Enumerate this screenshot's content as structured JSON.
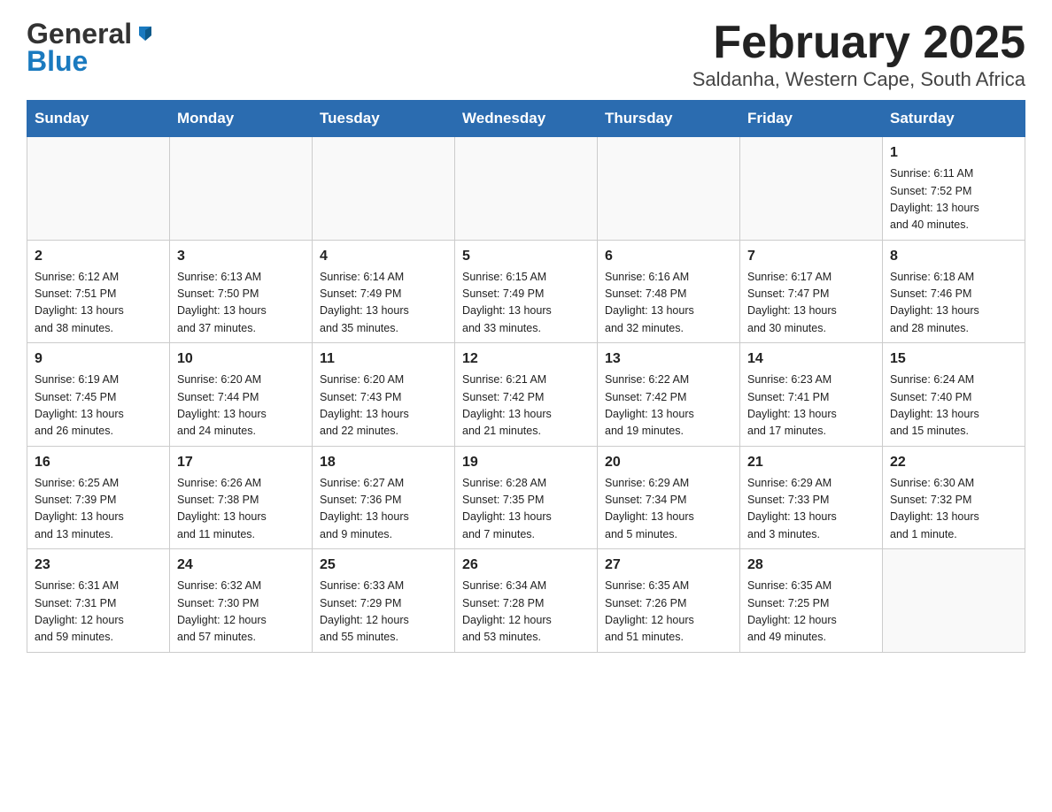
{
  "header": {
    "logo_general": "General",
    "logo_blue": "Blue",
    "title": "February 2025",
    "subtitle": "Saldanha, Western Cape, South Africa"
  },
  "days_of_week": [
    "Sunday",
    "Monday",
    "Tuesday",
    "Wednesday",
    "Thursday",
    "Friday",
    "Saturday"
  ],
  "weeks": [
    [
      {
        "day": "",
        "info": ""
      },
      {
        "day": "",
        "info": ""
      },
      {
        "day": "",
        "info": ""
      },
      {
        "day": "",
        "info": ""
      },
      {
        "day": "",
        "info": ""
      },
      {
        "day": "",
        "info": ""
      },
      {
        "day": "1",
        "info": "Sunrise: 6:11 AM\nSunset: 7:52 PM\nDaylight: 13 hours\nand 40 minutes."
      }
    ],
    [
      {
        "day": "2",
        "info": "Sunrise: 6:12 AM\nSunset: 7:51 PM\nDaylight: 13 hours\nand 38 minutes."
      },
      {
        "day": "3",
        "info": "Sunrise: 6:13 AM\nSunset: 7:50 PM\nDaylight: 13 hours\nand 37 minutes."
      },
      {
        "day": "4",
        "info": "Sunrise: 6:14 AM\nSunset: 7:49 PM\nDaylight: 13 hours\nand 35 minutes."
      },
      {
        "day": "5",
        "info": "Sunrise: 6:15 AM\nSunset: 7:49 PM\nDaylight: 13 hours\nand 33 minutes."
      },
      {
        "day": "6",
        "info": "Sunrise: 6:16 AM\nSunset: 7:48 PM\nDaylight: 13 hours\nand 32 minutes."
      },
      {
        "day": "7",
        "info": "Sunrise: 6:17 AM\nSunset: 7:47 PM\nDaylight: 13 hours\nand 30 minutes."
      },
      {
        "day": "8",
        "info": "Sunrise: 6:18 AM\nSunset: 7:46 PM\nDaylight: 13 hours\nand 28 minutes."
      }
    ],
    [
      {
        "day": "9",
        "info": "Sunrise: 6:19 AM\nSunset: 7:45 PM\nDaylight: 13 hours\nand 26 minutes."
      },
      {
        "day": "10",
        "info": "Sunrise: 6:20 AM\nSunset: 7:44 PM\nDaylight: 13 hours\nand 24 minutes."
      },
      {
        "day": "11",
        "info": "Sunrise: 6:20 AM\nSunset: 7:43 PM\nDaylight: 13 hours\nand 22 minutes."
      },
      {
        "day": "12",
        "info": "Sunrise: 6:21 AM\nSunset: 7:42 PM\nDaylight: 13 hours\nand 21 minutes."
      },
      {
        "day": "13",
        "info": "Sunrise: 6:22 AM\nSunset: 7:42 PM\nDaylight: 13 hours\nand 19 minutes."
      },
      {
        "day": "14",
        "info": "Sunrise: 6:23 AM\nSunset: 7:41 PM\nDaylight: 13 hours\nand 17 minutes."
      },
      {
        "day": "15",
        "info": "Sunrise: 6:24 AM\nSunset: 7:40 PM\nDaylight: 13 hours\nand 15 minutes."
      }
    ],
    [
      {
        "day": "16",
        "info": "Sunrise: 6:25 AM\nSunset: 7:39 PM\nDaylight: 13 hours\nand 13 minutes."
      },
      {
        "day": "17",
        "info": "Sunrise: 6:26 AM\nSunset: 7:38 PM\nDaylight: 13 hours\nand 11 minutes."
      },
      {
        "day": "18",
        "info": "Sunrise: 6:27 AM\nSunset: 7:36 PM\nDaylight: 13 hours\nand 9 minutes."
      },
      {
        "day": "19",
        "info": "Sunrise: 6:28 AM\nSunset: 7:35 PM\nDaylight: 13 hours\nand 7 minutes."
      },
      {
        "day": "20",
        "info": "Sunrise: 6:29 AM\nSunset: 7:34 PM\nDaylight: 13 hours\nand 5 minutes."
      },
      {
        "day": "21",
        "info": "Sunrise: 6:29 AM\nSunset: 7:33 PM\nDaylight: 13 hours\nand 3 minutes."
      },
      {
        "day": "22",
        "info": "Sunrise: 6:30 AM\nSunset: 7:32 PM\nDaylight: 13 hours\nand 1 minute."
      }
    ],
    [
      {
        "day": "23",
        "info": "Sunrise: 6:31 AM\nSunset: 7:31 PM\nDaylight: 12 hours\nand 59 minutes."
      },
      {
        "day": "24",
        "info": "Sunrise: 6:32 AM\nSunset: 7:30 PM\nDaylight: 12 hours\nand 57 minutes."
      },
      {
        "day": "25",
        "info": "Sunrise: 6:33 AM\nSunset: 7:29 PM\nDaylight: 12 hours\nand 55 minutes."
      },
      {
        "day": "26",
        "info": "Sunrise: 6:34 AM\nSunset: 7:28 PM\nDaylight: 12 hours\nand 53 minutes."
      },
      {
        "day": "27",
        "info": "Sunrise: 6:35 AM\nSunset: 7:26 PM\nDaylight: 12 hours\nand 51 minutes."
      },
      {
        "day": "28",
        "info": "Sunrise: 6:35 AM\nSunset: 7:25 PM\nDaylight: 12 hours\nand 49 minutes."
      },
      {
        "day": "",
        "info": ""
      }
    ]
  ]
}
